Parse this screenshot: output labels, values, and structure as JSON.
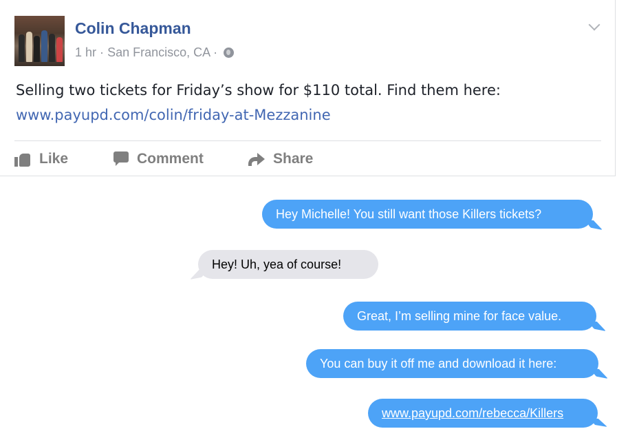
{
  "post": {
    "author": "Colin Chapman",
    "time": "1 hr",
    "location": "San Francisco, CA",
    "separator": "·",
    "text_prefix": "Selling two tickets for Friday’s show for $110 total. Find them here: ",
    "link": "www.payupd.com/colin/friday-at-Mezzanine",
    "actions": {
      "like": "Like",
      "comment": "Comment",
      "share": "Share"
    },
    "colors": {
      "author": "#365899",
      "link": "#4267b2"
    }
  },
  "messages": [
    {
      "side": "right",
      "text": "Hey Michelle! You still want those Killers tickets?"
    },
    {
      "side": "left",
      "text": "Hey! Uh, yea of course!"
    },
    {
      "side": "right",
      "text": "Great, I’m selling mine for face value."
    },
    {
      "side": "right",
      "text": "You can buy it off me and download it here:"
    },
    {
      "side": "right",
      "text": "www.payupd.com/rebecca/Killers"
    }
  ],
  "colors": {
    "sent": "#4da3f7",
    "received": "#e5e5ea"
  }
}
